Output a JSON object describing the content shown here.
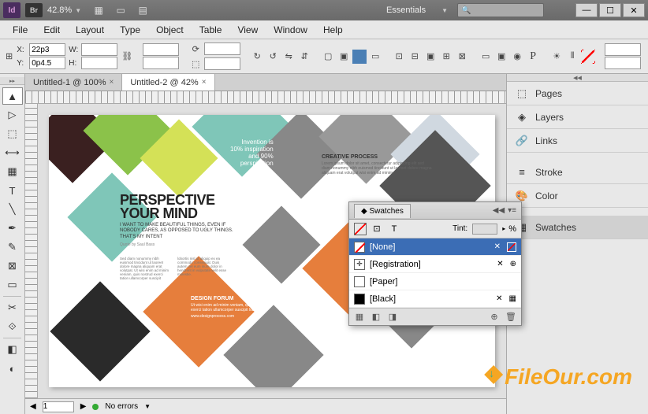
{
  "titlebar": {
    "id_logo": "Id",
    "br_logo": "Br",
    "zoom": "42.8%",
    "workspace": "Essentials"
  },
  "window_controls": {
    "min": "—",
    "max": "☐",
    "close": "✕"
  },
  "menu": [
    "File",
    "Edit",
    "Layout",
    "Type",
    "Object",
    "Table",
    "View",
    "Window",
    "Help"
  ],
  "control": {
    "x": "22p3",
    "y": "0p4.5",
    "w": "",
    "h": ""
  },
  "tabs": [
    {
      "label": "Untitled-1 @ 100%",
      "active": false
    },
    {
      "label": "Untitled-2 @ 42%",
      "active": true
    }
  ],
  "canvas": {
    "headline": "PERSPECTIVE",
    "headline2": "YOUR MIND",
    "sub": "I WANT TO MAKE BEAUTIFUL THINGS, EVEN IF NOBODY CARES, AS OPPOSED TO UGLY THINGS. THAT'S MY INTENT",
    "quote_by": "Quote by Saul Bass",
    "inspire1": "Invention is",
    "inspire2": "10% inspiration",
    "inspire3": "and 90%",
    "inspire4": "perspiration",
    "creative_title": "CREATIVE PROCESS",
    "creative_body": "Lorem ipsum dolor sit amet, consectetur adipiscing elit sed diam nonummy nibh euismod tincidunt ut laoreet dolore magna aliquam erat volutpat wisi enim ad minim",
    "design_title": "DESIGN FORUM",
    "design_body": "Ut wisi enim ad minim veniam, quis nostrud exerci tation ullamcorper suscipit lobortis",
    "design_link": "www.designprocess.com",
    "lorem": "Sed diam nonummy nibh euismod tincidunt ut laoreet dolore magna aliquam erat volutpat. Ut wisi enim ad minim veniam, quis nostrud exerci tation ullamcorper suscipit lobortis nisl ut aliquip ex ea commodo consequat. Duis autem vel eum iriure dolor in hendrerit in vulputate velit esse molestie."
  },
  "statusbar": {
    "page": "1",
    "errors": "No errors"
  },
  "right_panels": [
    "Pages",
    "Layers",
    "Links",
    "Stroke",
    "Color",
    "Swatches"
  ],
  "swatches": {
    "title": "Swatches",
    "tint_label": "Tint:",
    "tint_suffix": "%",
    "rows": [
      {
        "name": "[None]",
        "chip": "none",
        "selected": true
      },
      {
        "name": "[Registration]",
        "chip": "reg",
        "selected": false
      },
      {
        "name": "[Paper]",
        "chip": "paper",
        "selected": false
      },
      {
        "name": "[Black]",
        "chip": "black",
        "selected": false
      }
    ]
  },
  "watermark": "FileOur.com"
}
